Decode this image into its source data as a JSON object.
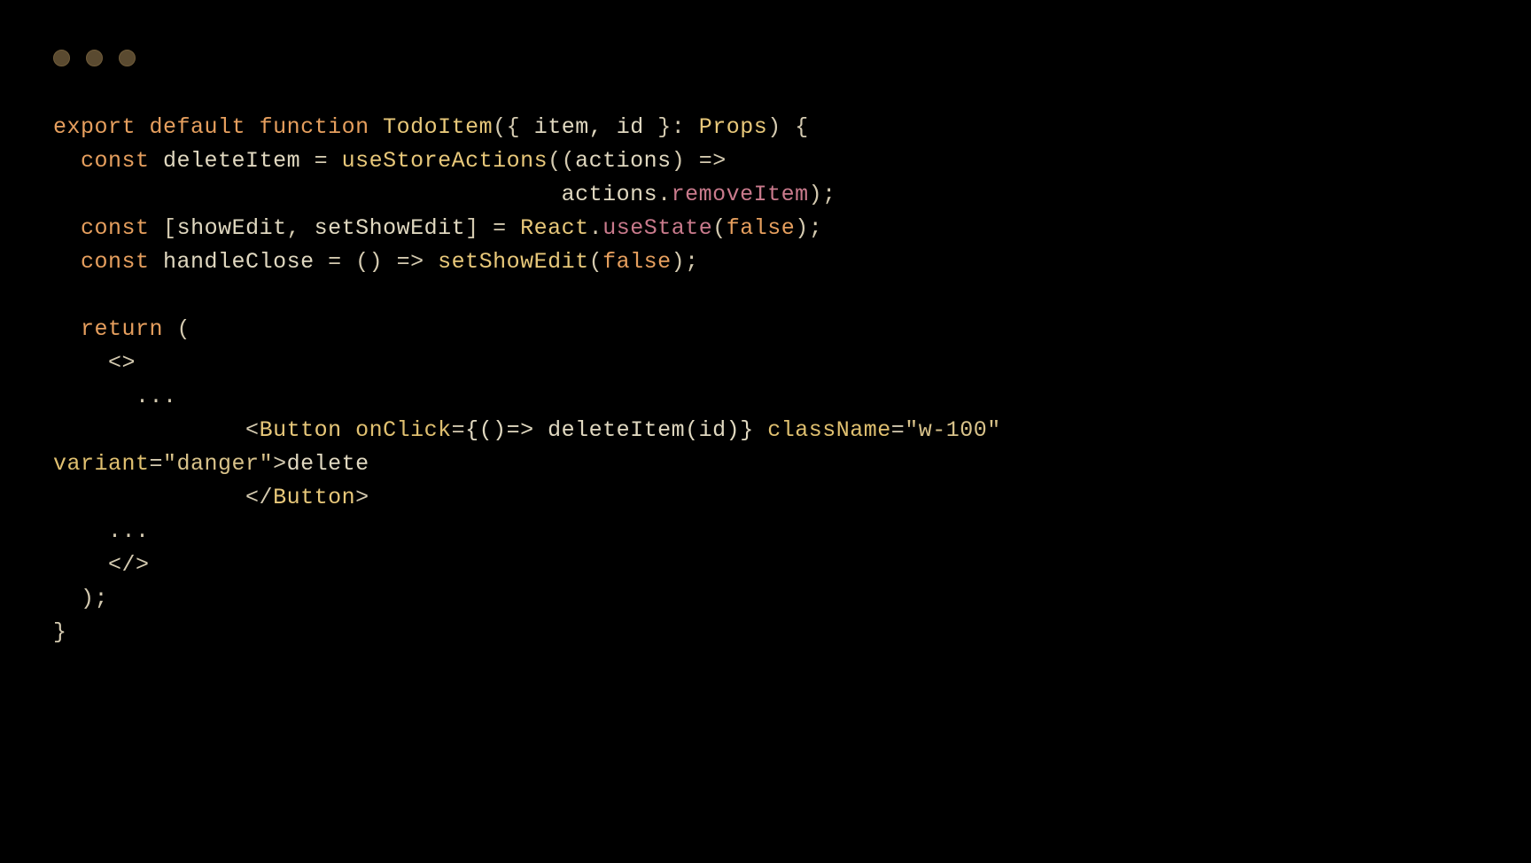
{
  "traffic_lights": {
    "close": "close",
    "minimize": "minimize",
    "zoom": "zoom"
  },
  "code": {
    "line1": {
      "export": "export",
      "default": "default",
      "function": "function",
      "fnName": "TodoItem",
      "paren_open": "(",
      "brace_open": "{ ",
      "params": "item, id",
      "brace_close": " }",
      "colon": ": ",
      "type": "Props",
      "paren_close": ") {",
      "sp1": " ",
      "sp2": " ",
      "sp3": " "
    },
    "line2": {
      "indent": "  ",
      "const": "const",
      "sp": " ",
      "name": "deleteItem",
      "eq": " = ",
      "fn": "useStoreActions",
      "paren": "((",
      "arg": "actions",
      "arrow": ") =>"
    },
    "line3": {
      "indent": "                                     ",
      "obj": "actions",
      "dot": ".",
      "method": "removeItem",
      "close": ");"
    },
    "line4": {
      "indent": "  ",
      "const": "const",
      "sp": " ",
      "bracket_open": "[",
      "v1": "showEdit",
      "comma": ", ",
      "v2": "setShowEdit",
      "bracket_close": "] = ",
      "react": "React",
      "dot": ".",
      "useState": "useState",
      "paren_open": "(",
      "false": "false",
      "paren_close": ");"
    },
    "line5": {
      "indent": "  ",
      "const": "const",
      "sp": " ",
      "name": "handleClose",
      "eq": " = () => ",
      "fn": "setShowEdit",
      "paren_open": "(",
      "false": "false",
      "paren_close": ");"
    },
    "line6": "",
    "line7": {
      "indent": "  ",
      "return": "return",
      "sp": " (",
      "paren": ""
    },
    "line8": {
      "indent": "    ",
      "frag": "<>"
    },
    "line9": {
      "indent": "      ",
      "dots": "..."
    },
    "line10": {
      "indent": "              ",
      "open": "<",
      "tag": "Button",
      "sp1": " ",
      "attr1": "onClick",
      "eq1": "=",
      "val1": "{()=> deleteItem(id)}",
      "sp2": " ",
      "attr2": "className",
      "eq2": "=",
      "val2": "\"w-100\""
    },
    "line11": {
      "attr": "variant",
      "eq": "=",
      "val": "\"danger\"",
      "gt": ">",
      "text": "delete"
    },
    "line12": {
      "indent": "              ",
      "close": "</",
      "tag": "Button",
      "gt": ">"
    },
    "line13": {
      "indent": "    ",
      "dots": "..."
    },
    "line14": {
      "indent": "    ",
      "frag": "</>"
    },
    "line15": {
      "indent": "  ",
      "close": ");"
    },
    "line16": {
      "close": "}"
    }
  }
}
